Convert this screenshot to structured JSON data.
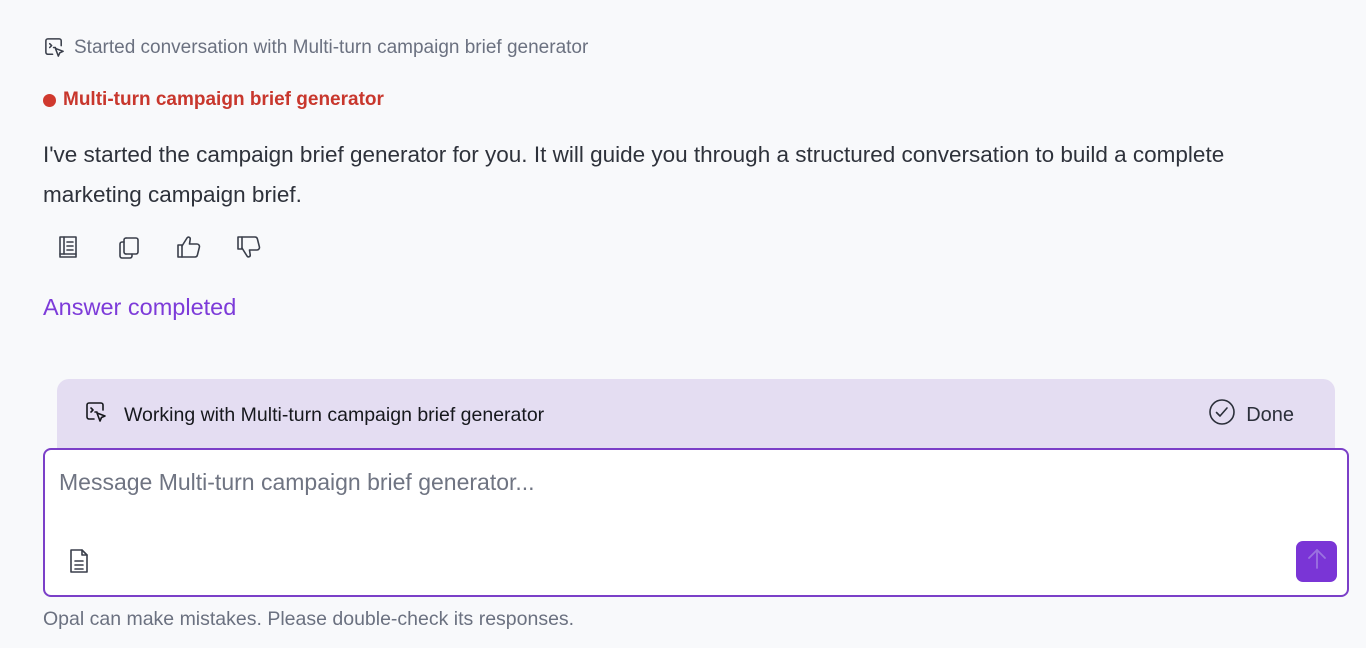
{
  "event": {
    "icon": "agent-cursor-icon",
    "text": "Started conversation with Multi-turn campaign brief generator"
  },
  "agent": {
    "name": "Multi-turn campaign brief generator",
    "dot_color": "#d0392e"
  },
  "message": {
    "text": "I've started the campaign brief generator for you. It will guide you through a structured conversation to build a complete marketing campaign brief."
  },
  "actions": [
    {
      "icon": "sources-book-icon"
    },
    {
      "icon": "copy-icon"
    },
    {
      "icon": "thumbs-up-icon"
    },
    {
      "icon": "thumbs-down-icon"
    }
  ],
  "answer_status": "Answer completed",
  "working_bar": {
    "icon": "agent-cursor-icon",
    "label": "Working with Multi-turn campaign brief generator",
    "done_icon": "check-circle-icon",
    "done_label": "Done"
  },
  "composer": {
    "placeholder": "Message Multi-turn campaign brief generator...",
    "value": "",
    "attach_icon": "document-icon",
    "send_icon": "arrow-up-icon"
  },
  "disclaimer": "Opal can make mistakes. Please double-check its responses.",
  "colors": {
    "accent": "#7a35d6",
    "agent_red": "#c8372d",
    "working_bar_bg": "#e4ddf2",
    "page_bg": "#f8f9fb"
  }
}
